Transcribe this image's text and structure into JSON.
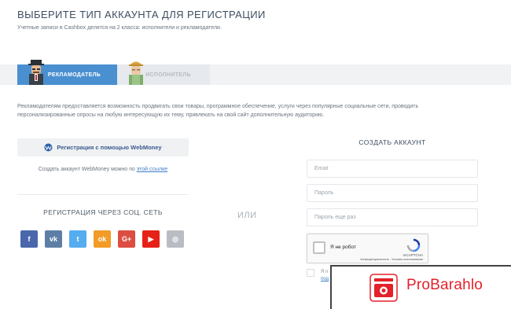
{
  "header": {
    "title": "ВЫБЕРИТЕ ТИП АККАУНТА ДЛЯ РЕГИСТРАЦИИ",
    "subtitle": "Учетные записи в Cashbox делятся на 2 класса: исполнители и рекламодатели."
  },
  "tabs": [
    {
      "label": "РЕКЛАМОДАТЕЛЬ",
      "active": true,
      "icon": "advertiser-avatar-icon"
    },
    {
      "label": "ИСПОЛНИТЕЛЬ",
      "active": false,
      "icon": "executor-avatar-icon"
    }
  ],
  "description": "Рекламодателям предоставляется возможность продвигать свои товары, программное обеспечение, услуги через популярные социальные сети, проводить персонализированные опросы на любую интересующую их тему, привлекать на свой сайт дополнительную аудиторию.",
  "webmoney": {
    "button_label": "Регистрация с помощью WebMoney",
    "note_prefix": "Создать аккаунт WebMoney можно по",
    "note_link": "этой ссылке"
  },
  "social": {
    "title": "РЕГИСТРАЦИЯ ЧЕРЕЗ СОЦ. СЕТЬ",
    "networks": [
      {
        "name": "facebook",
        "glyph": "f",
        "color": "#4a67ad"
      },
      {
        "name": "vk",
        "glyph": "vk",
        "color": "#5d7fa6"
      },
      {
        "name": "twitter",
        "glyph": "t",
        "color": "#55acee"
      },
      {
        "name": "odnoklassniki",
        "glyph": "ok",
        "color": "#f29b26"
      },
      {
        "name": "google-plus",
        "glyph": "G+",
        "color": "#dc4e41"
      },
      {
        "name": "youtube",
        "glyph": "▶",
        "color": "#e62117"
      },
      {
        "name": "instagram",
        "glyph": "◎",
        "color": "#b9bdc3"
      }
    ]
  },
  "separator": "ИЛИ",
  "signup": {
    "title": "СОЗДАТЬ АККАУНТ",
    "email_placeholder": "Email",
    "password_placeholder": "Пароль",
    "password_repeat_placeholder": "Пароль еще раз"
  },
  "recaptcha": {
    "label": "Я не робот",
    "brand": "reCAPTCHA",
    "links": "Конфиденциальность - Условия использования"
  },
  "terms": {
    "text": "Я п",
    "link": "под"
  },
  "watermark": {
    "brand": "ProBarahlo",
    "color": "#e3212a"
  },
  "colors": {
    "accent": "#4a90d0",
    "link": "#3f7fc6"
  }
}
